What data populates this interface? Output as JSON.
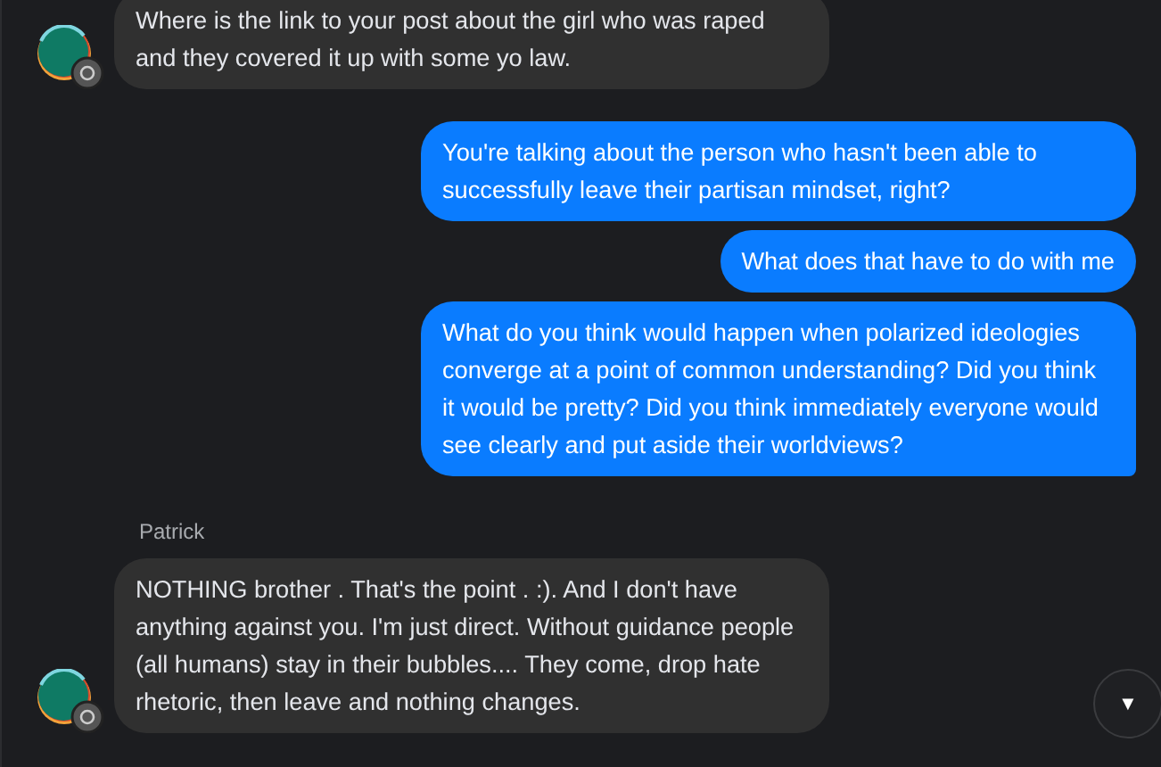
{
  "messages": [
    {
      "kind": "received",
      "text": "Where is the link to your post about the girl who was raped and they covered it up with some yo law.",
      "avatar": true
    },
    {
      "kind": "sent",
      "text": "You're talking about the person who hasn't been able to successfully leave their partisan mindset, right?"
    },
    {
      "kind": "sent",
      "text": "What does that have to do with me"
    },
    {
      "kind": "sent",
      "text": "What do you think would happen when polarized ideologies converge at a point of common understanding? Did you think it would be pretty? Did you think immediately everyone would see clearly and put aside their worldviews?",
      "delivered": true
    },
    {
      "kind": "received",
      "sender": "Patrick",
      "text": "NOTHING brother . That's the point . :). And I don't have anything against you. I'm just direct. Without guidance people (all humans) stay in their bubbles.... They come, drop hate rhetoric, then leave and nothing changes.",
      "avatar": true
    }
  ],
  "scroll_button": {
    "icon": "▼"
  }
}
